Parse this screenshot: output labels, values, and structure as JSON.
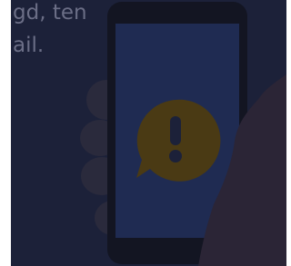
{
  "background_text": {
    "line1": "gd, ten",
    "line2": "ail."
  },
  "illustration": {
    "subject": "hand-holding-phone",
    "alert_icon": "exclamation-bubble-icon",
    "colors": {
      "panel": "#1c2139",
      "phone_body": "#131522",
      "phone_screen": "#1f2b52",
      "alert_bubble": "#4a3a14",
      "alert_mark": "#1c2139",
      "fingers": "#2a2a3c",
      "thumb": "#2b2536"
    }
  }
}
